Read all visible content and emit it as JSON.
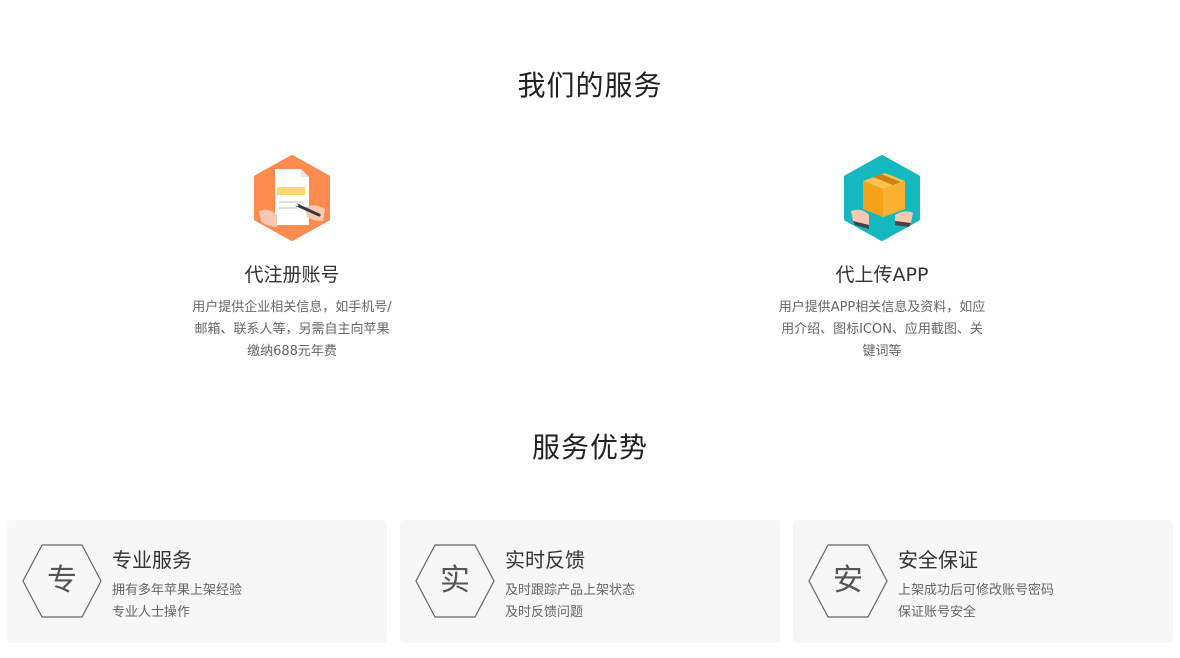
{
  "services_section": {
    "title": "我们的服务",
    "items": [
      {
        "icon": "document-sign-icon",
        "title": "代注册账号",
        "desc_lines": [
          "用户提供企业相关信息，如手机号/",
          "邮箱、联系人等，另需自主向苹果",
          "缴纳688元年费"
        ]
      },
      {
        "icon": "package-box-icon",
        "title": "代上传APP",
        "desc_lines": [
          "用户提供APP相关信息及资料，如应",
          "用介绍、图标ICON、应用截图、关",
          "键词等"
        ]
      }
    ]
  },
  "advantages_section": {
    "title": "服务优势",
    "items": [
      {
        "char": "专",
        "title": "专业服务",
        "desc_lines": [
          "拥有多年苹果上架经验",
          "专业人士操作"
        ]
      },
      {
        "char": "实",
        "title": "实时反馈",
        "desc_lines": [
          "及时跟踪产品上架状态",
          "及时反馈问题"
        ]
      },
      {
        "char": "安",
        "title": "安全保证",
        "desc_lines": [
          "上架成功后可修改账号密码",
          "保证账号安全"
        ]
      }
    ]
  },
  "colors": {
    "register_icon_bg": "#fd8a4e",
    "upload_icon_bg": "#15b8bf",
    "card_bg": "#f7f7f7",
    "hex_stroke": "#666666"
  }
}
